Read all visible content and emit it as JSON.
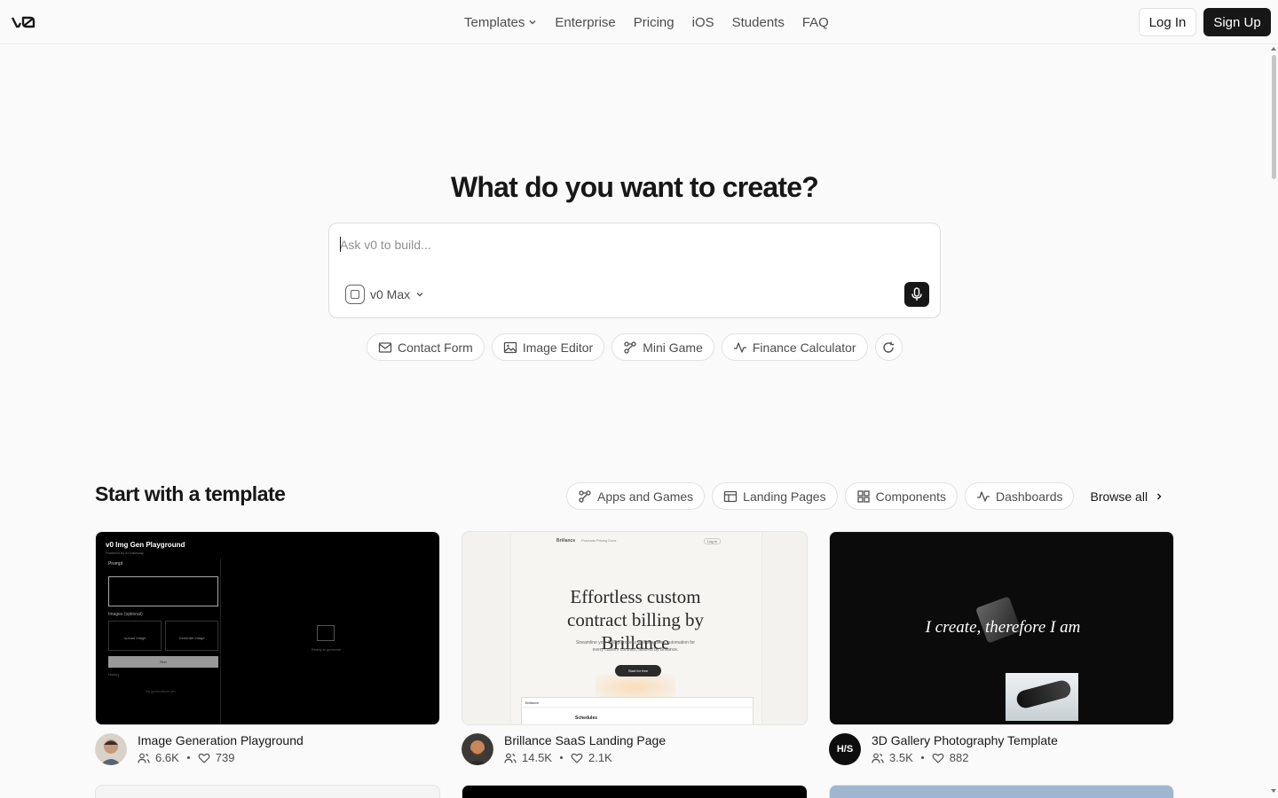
{
  "header": {
    "logo_text": "v0",
    "nav": [
      {
        "label": "Templates",
        "has_dropdown": true
      },
      {
        "label": "Enterprise"
      },
      {
        "label": "Pricing"
      },
      {
        "label": "iOS"
      },
      {
        "label": "Students"
      },
      {
        "label": "FAQ"
      }
    ],
    "login_label": "Log In",
    "signup_label": "Sign Up"
  },
  "hero": {
    "title": "What do you want to create?",
    "prompt_placeholder": "Ask v0 to build...",
    "prompt_value": "",
    "model_label": "v0 Max",
    "chips": [
      {
        "label": "Contact Form",
        "icon": "mail-icon"
      },
      {
        "label": "Image Editor",
        "icon": "image-icon"
      },
      {
        "label": "Mini Game",
        "icon": "nodes-icon"
      },
      {
        "label": "Finance Calculator",
        "icon": "activity-icon"
      }
    ]
  },
  "templates": {
    "title": "Start with a template",
    "filters": [
      {
        "label": "Apps and Games",
        "icon": "nodes-icon"
      },
      {
        "label": "Landing Pages",
        "icon": "layout-icon"
      },
      {
        "label": "Components",
        "icon": "grid-icon"
      },
      {
        "label": "Dashboards",
        "icon": "activity-icon"
      }
    ],
    "browse_all": "Browse all",
    "cards": [
      {
        "title": "Image Generation Playground",
        "users": "6.6K",
        "likes": "739",
        "thumb": {
          "app_title": "v0 Img Gen Playground",
          "app_sub": "Powered by AI Gateway",
          "prompt_label": "Prompt",
          "images_label": "Images (optional)",
          "upload_label": "Upload Image",
          "generate_label": "Generate Image",
          "run_label": "Run",
          "history_label": "History",
          "no_gen": "No generations yet",
          "ready": "Ready to generate"
        }
      },
      {
        "title": "Brillance SaaS Landing Page",
        "users": "14.5K",
        "likes": "2.1K",
        "thumb": {
          "brand": "Brillance",
          "nav": "Products  Pricing  Docs",
          "login": "Log in",
          "headline": "Effortless custom contract billing by Brillance",
          "sub": "Streamline your billing process with seamless automation for every custom contract, tailored by Brillance.",
          "cta": "Start for free",
          "panel_title": "Schedules"
        }
      },
      {
        "title": "3D Gallery Photography Template",
        "users": "3.5K",
        "likes": "882",
        "avatar_text": "H/S",
        "thumb": {
          "text": "I create, therefore I am"
        }
      }
    ]
  },
  "colors": {
    "background": "#fafafa",
    "primary": "#171717",
    "muted_text": "#4d4d4d",
    "border": "#e2e2e2"
  }
}
